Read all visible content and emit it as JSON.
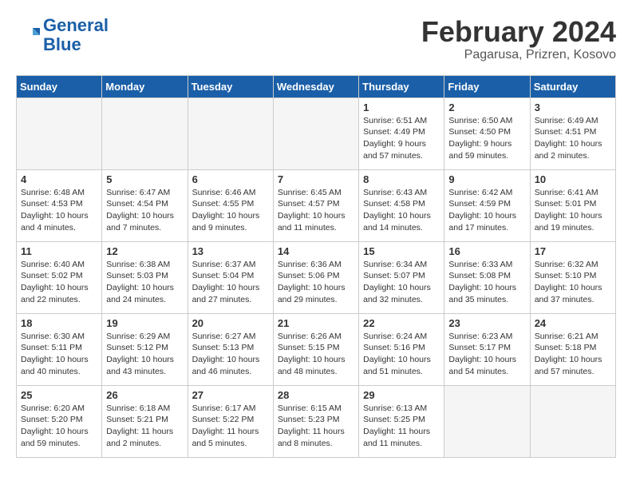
{
  "header": {
    "logo": {
      "line1": "General",
      "line2": "Blue"
    },
    "title": "February 2024",
    "subtitle": "Pagarusa, Prizren, Kosovo"
  },
  "weekdays": [
    "Sunday",
    "Monday",
    "Tuesday",
    "Wednesday",
    "Thursday",
    "Friday",
    "Saturday"
  ],
  "weeks": [
    [
      {
        "day": "",
        "info": ""
      },
      {
        "day": "",
        "info": ""
      },
      {
        "day": "",
        "info": ""
      },
      {
        "day": "",
        "info": ""
      },
      {
        "day": "1",
        "info": "Sunrise: 6:51 AM\nSunset: 4:49 PM\nDaylight: 9 hours\nand 57 minutes."
      },
      {
        "day": "2",
        "info": "Sunrise: 6:50 AM\nSunset: 4:50 PM\nDaylight: 9 hours\nand 59 minutes."
      },
      {
        "day": "3",
        "info": "Sunrise: 6:49 AM\nSunset: 4:51 PM\nDaylight: 10 hours\nand 2 minutes."
      }
    ],
    [
      {
        "day": "4",
        "info": "Sunrise: 6:48 AM\nSunset: 4:53 PM\nDaylight: 10 hours\nand 4 minutes."
      },
      {
        "day": "5",
        "info": "Sunrise: 6:47 AM\nSunset: 4:54 PM\nDaylight: 10 hours\nand 7 minutes."
      },
      {
        "day": "6",
        "info": "Sunrise: 6:46 AM\nSunset: 4:55 PM\nDaylight: 10 hours\nand 9 minutes."
      },
      {
        "day": "7",
        "info": "Sunrise: 6:45 AM\nSunset: 4:57 PM\nDaylight: 10 hours\nand 11 minutes."
      },
      {
        "day": "8",
        "info": "Sunrise: 6:43 AM\nSunset: 4:58 PM\nDaylight: 10 hours\nand 14 minutes."
      },
      {
        "day": "9",
        "info": "Sunrise: 6:42 AM\nSunset: 4:59 PM\nDaylight: 10 hours\nand 17 minutes."
      },
      {
        "day": "10",
        "info": "Sunrise: 6:41 AM\nSunset: 5:01 PM\nDaylight: 10 hours\nand 19 minutes."
      }
    ],
    [
      {
        "day": "11",
        "info": "Sunrise: 6:40 AM\nSunset: 5:02 PM\nDaylight: 10 hours\nand 22 minutes."
      },
      {
        "day": "12",
        "info": "Sunrise: 6:38 AM\nSunset: 5:03 PM\nDaylight: 10 hours\nand 24 minutes."
      },
      {
        "day": "13",
        "info": "Sunrise: 6:37 AM\nSunset: 5:04 PM\nDaylight: 10 hours\nand 27 minutes."
      },
      {
        "day": "14",
        "info": "Sunrise: 6:36 AM\nSunset: 5:06 PM\nDaylight: 10 hours\nand 29 minutes."
      },
      {
        "day": "15",
        "info": "Sunrise: 6:34 AM\nSunset: 5:07 PM\nDaylight: 10 hours\nand 32 minutes."
      },
      {
        "day": "16",
        "info": "Sunrise: 6:33 AM\nSunset: 5:08 PM\nDaylight: 10 hours\nand 35 minutes."
      },
      {
        "day": "17",
        "info": "Sunrise: 6:32 AM\nSunset: 5:10 PM\nDaylight: 10 hours\nand 37 minutes."
      }
    ],
    [
      {
        "day": "18",
        "info": "Sunrise: 6:30 AM\nSunset: 5:11 PM\nDaylight: 10 hours\nand 40 minutes."
      },
      {
        "day": "19",
        "info": "Sunrise: 6:29 AM\nSunset: 5:12 PM\nDaylight: 10 hours\nand 43 minutes."
      },
      {
        "day": "20",
        "info": "Sunrise: 6:27 AM\nSunset: 5:13 PM\nDaylight: 10 hours\nand 46 minutes."
      },
      {
        "day": "21",
        "info": "Sunrise: 6:26 AM\nSunset: 5:15 PM\nDaylight: 10 hours\nand 48 minutes."
      },
      {
        "day": "22",
        "info": "Sunrise: 6:24 AM\nSunset: 5:16 PM\nDaylight: 10 hours\nand 51 minutes."
      },
      {
        "day": "23",
        "info": "Sunrise: 6:23 AM\nSunset: 5:17 PM\nDaylight: 10 hours\nand 54 minutes."
      },
      {
        "day": "24",
        "info": "Sunrise: 6:21 AM\nSunset: 5:18 PM\nDaylight: 10 hours\nand 57 minutes."
      }
    ],
    [
      {
        "day": "25",
        "info": "Sunrise: 6:20 AM\nSunset: 5:20 PM\nDaylight: 10 hours\nand 59 minutes."
      },
      {
        "day": "26",
        "info": "Sunrise: 6:18 AM\nSunset: 5:21 PM\nDaylight: 11 hours\nand 2 minutes."
      },
      {
        "day": "27",
        "info": "Sunrise: 6:17 AM\nSunset: 5:22 PM\nDaylight: 11 hours\nand 5 minutes."
      },
      {
        "day": "28",
        "info": "Sunrise: 6:15 AM\nSunset: 5:23 PM\nDaylight: 11 hours\nand 8 minutes."
      },
      {
        "day": "29",
        "info": "Sunrise: 6:13 AM\nSunset: 5:25 PM\nDaylight: 11 hours\nand 11 minutes."
      },
      {
        "day": "",
        "info": ""
      },
      {
        "day": "",
        "info": ""
      }
    ]
  ]
}
